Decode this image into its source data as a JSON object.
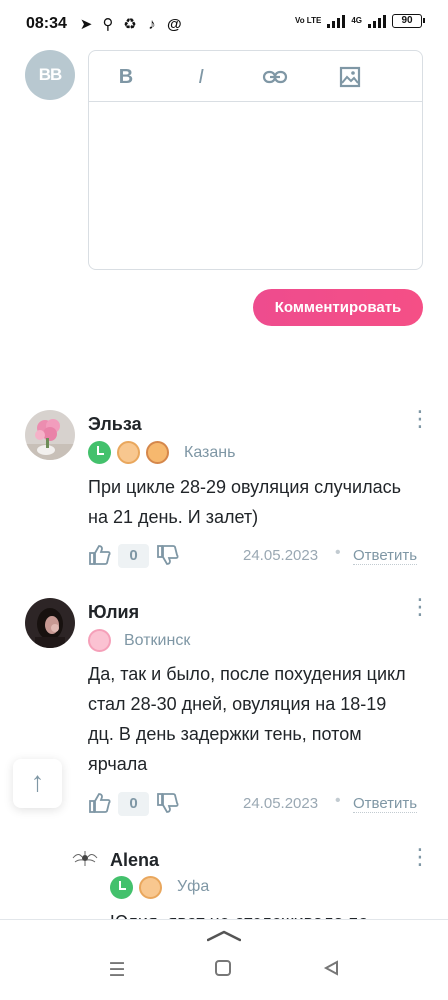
{
  "status_bar": {
    "time": "08:34",
    "left_icons": [
      "telegram-icon",
      "search-icon",
      "recycle-icon",
      "tiktok-icon",
      "at-icon"
    ],
    "volte_label": "Vo LTE",
    "network_label": "4G",
    "battery": "90"
  },
  "editor": {
    "avatar_initials": "BB",
    "toolbar": {
      "bold": "B",
      "italic": "I"
    },
    "submit_label": "Комментировать"
  },
  "comments": [
    {
      "author": "Эльза",
      "city": "Казань",
      "text": "При цикле 28-29 овуляция случилась на 21 день. И залет)",
      "likes": "0",
      "date": "24.05.2023",
      "reply_label": "Ответить"
    },
    {
      "author": "Юлия",
      "city": "Воткинск",
      "text": "Да, так и было, после похудения цикл стал 28-30 дней, овуляция на 18-19 дц. В день задержки тень, потом ярчала",
      "likes": "0",
      "date": "24.05.2023",
      "reply_label": "Ответить"
    },
    {
      "author": "Alena",
      "city": "Уфа",
      "text": "Юлия, явот не отслеживала по"
    }
  ],
  "colors": {
    "accent": "#ee4c8e",
    "muted": "#7f97a5",
    "cycle_badge": "#43c16c"
  }
}
